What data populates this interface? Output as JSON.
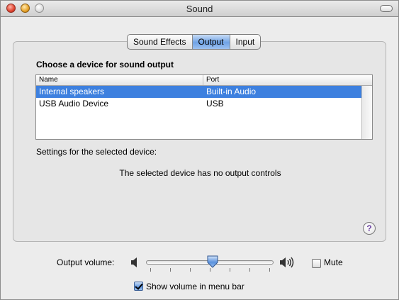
{
  "window": {
    "title": "Sound"
  },
  "tabs": [
    {
      "label": "Sound Effects",
      "active": false
    },
    {
      "label": "Output",
      "active": true
    },
    {
      "label": "Input",
      "active": false
    }
  ],
  "output": {
    "heading": "Choose a device for sound output",
    "table": {
      "columns": [
        "Name",
        "Port"
      ],
      "rows": [
        {
          "name": "Internal speakers",
          "port": "Built-in Audio",
          "selected": true
        },
        {
          "name": "USB Audio Device",
          "port": "USB",
          "selected": false
        }
      ]
    },
    "settings_label": "Settings for the selected device:",
    "no_controls_message": "The selected device has no output controls",
    "help_label": "?"
  },
  "volume": {
    "label": "Output volume:",
    "level": 0.52,
    "tick_count": 7,
    "low_icon": "speaker-low-icon",
    "high_icon": "speaker-high-icon"
  },
  "mute": {
    "label": "Mute",
    "checked": false
  },
  "menubar": {
    "label": "Show volume in menu bar",
    "checked": true
  },
  "colors": {
    "selection": "#3d80df",
    "window_bg": "#ececec",
    "active_tab": "#6fa3e6"
  }
}
